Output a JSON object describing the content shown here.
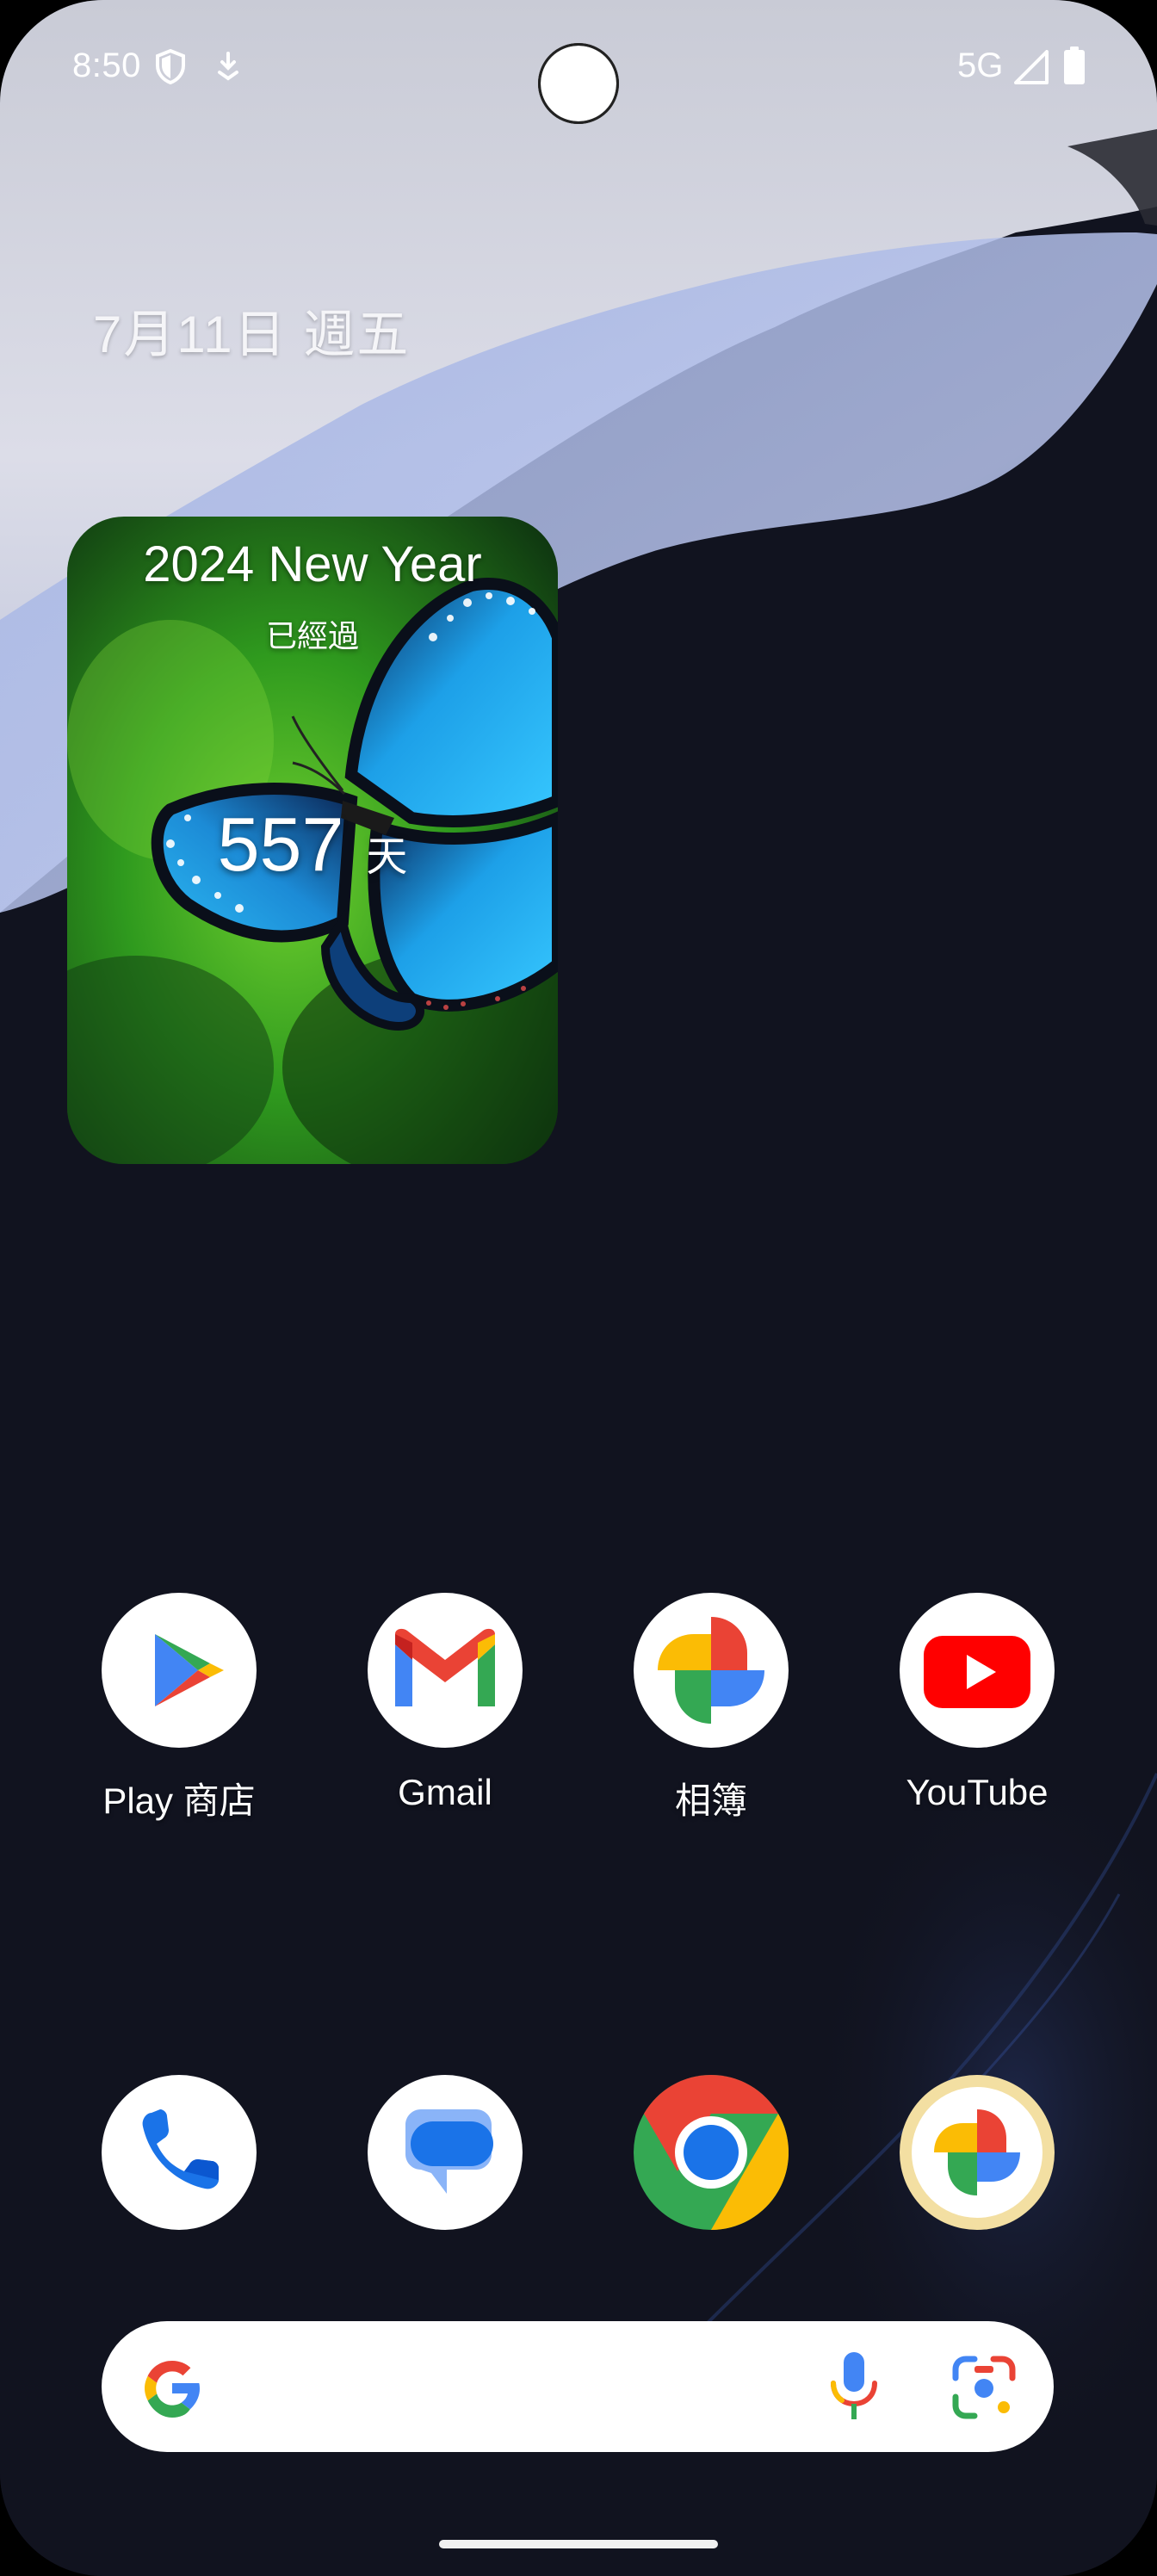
{
  "status_bar": {
    "time": "8:50",
    "network": "5G",
    "icons": [
      "shield-icon",
      "download-icon",
      "cell-signal-icon",
      "battery-icon"
    ]
  },
  "date_label": "7月11日 週五",
  "widget": {
    "title": "2024 New Year",
    "subtitle": "已經過",
    "count": "557",
    "unit": "天",
    "image": "butterfly-photo"
  },
  "apps": [
    {
      "label": "Play 商店",
      "icon": "play-store-icon"
    },
    {
      "label": "Gmail",
      "icon": "gmail-icon"
    },
    {
      "label": "相簿",
      "icon": "photos-icon"
    },
    {
      "label": "YouTube",
      "icon": "youtube-icon"
    }
  ],
  "dock": [
    {
      "icon": "phone-icon"
    },
    {
      "icon": "messages-icon"
    },
    {
      "icon": "chrome-icon"
    },
    {
      "icon": "photos-themed-icon"
    }
  ],
  "search_bar": {
    "icons": [
      "google-g-icon",
      "microphone-icon",
      "lens-icon"
    ]
  },
  "colors": {
    "background": "#11131f",
    "google_blue": "#4285F4",
    "google_red": "#EA4335",
    "google_yellow": "#FBBC05",
    "google_green": "#34A853",
    "youtube_red": "#FF0000"
  }
}
